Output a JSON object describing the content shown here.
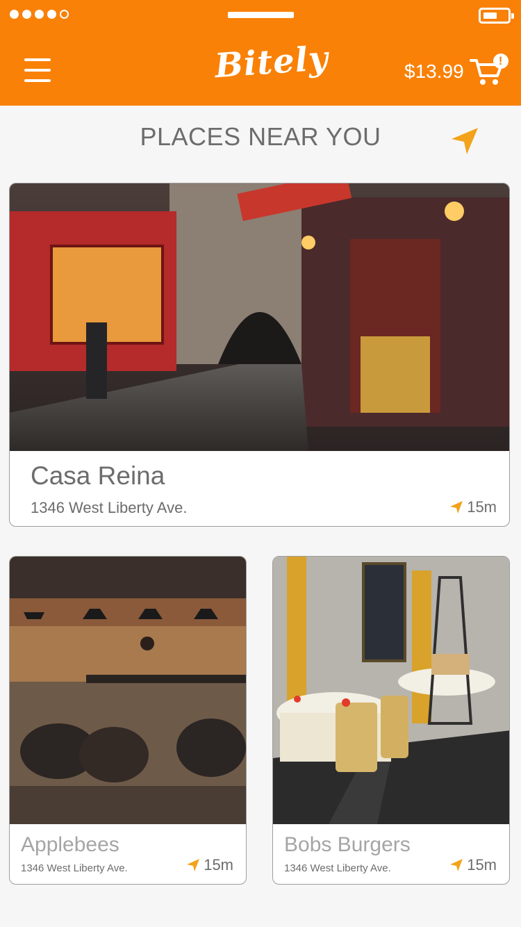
{
  "status_bar": {
    "signal_dots_filled": 4,
    "signal_dots_total": 5,
    "battery_level": 0.5
  },
  "header": {
    "brand": "Bitely",
    "cart_total": "$13.99",
    "cart_badge": "!",
    "accent_color": "#f98107"
  },
  "section": {
    "title": "PLACES NEAR YOU",
    "locate_icon": "navigation-arrow-icon",
    "icon_color": "#f3a21b"
  },
  "places": [
    {
      "name": "Casa Reina",
      "address": "1346 West Liberty Ave.",
      "distance": "15m"
    },
    {
      "name": "Applebees",
      "address": "1346 West Liberty Ave.",
      "distance": "15m"
    },
    {
      "name": "Bobs Burgers",
      "address": "1346 West Liberty Ave.",
      "distance": "15m"
    }
  ]
}
